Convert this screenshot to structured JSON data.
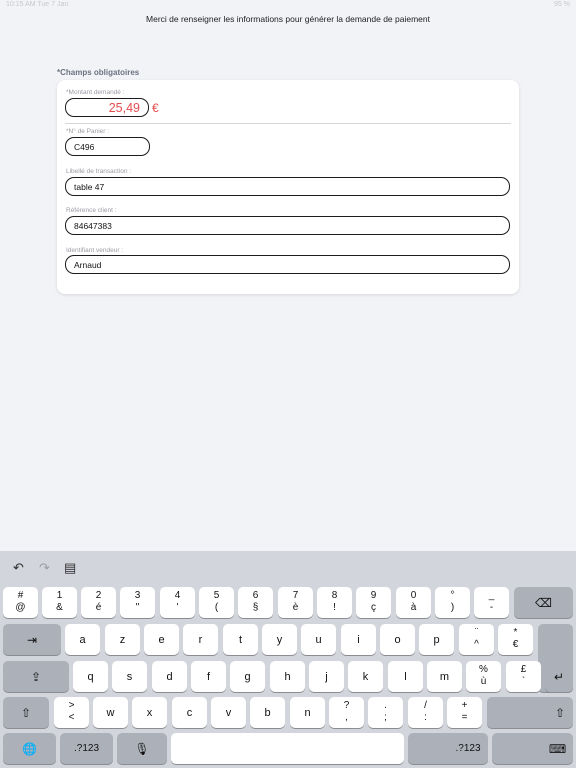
{
  "status": {
    "left": "10:15 AM   Tue 7 Jan",
    "right": "95 %"
  },
  "instruction": "Merci de renseigner les informations pour générer la demande de paiement",
  "required_label": "*Champs obligatoires",
  "form": {
    "amount": {
      "label": "*Montant demandé :",
      "value": "25,49",
      "currency": "€"
    },
    "cart": {
      "label": "*N° de Panier :",
      "value": "C496"
    },
    "transaction": {
      "label": "Libellé de transaction :",
      "value": "table 47"
    },
    "client_ref": {
      "label": "Référence client :",
      "value": "84647383"
    },
    "seller": {
      "label": "Identifiant vendeur :",
      "value": "Arnaud"
    }
  },
  "colors": {
    "accent": "#e74c4c",
    "background": "#f2f3f7",
    "keyboard": "#d3d5dc"
  },
  "keyboard": {
    "toolbar": {
      "undo": "↶",
      "redo": "↷",
      "paste": "▤"
    },
    "row1": [
      {
        "top": "#",
        "bot": "@"
      },
      {
        "top": "1",
        "bot": "&"
      },
      {
        "top": "2",
        "bot": "é"
      },
      {
        "top": "3",
        "bot": "\""
      },
      {
        "top": "4",
        "bot": "'"
      },
      {
        "top": "5",
        "bot": "("
      },
      {
        "top": "6",
        "bot": "§"
      },
      {
        "top": "7",
        "bot": "è"
      },
      {
        "top": "8",
        "bot": "!"
      },
      {
        "top": "9",
        "bot": "ç"
      },
      {
        "top": "0",
        "bot": "à"
      },
      {
        "top": "°",
        "bot": ")"
      },
      {
        "top": "_",
        "bot": "-"
      }
    ],
    "backspace": "⌫",
    "tab": "⇥",
    "row2": [
      "a",
      "z",
      "e",
      "r",
      "t",
      "y",
      "u",
      "i",
      "o",
      "p"
    ],
    "row2_extra": [
      {
        "top": "¨",
        "bot": "^"
      },
      {
        "top": "*",
        "bot": "€"
      }
    ],
    "capslock": "⇪",
    "row3": [
      "q",
      "s",
      "d",
      "f",
      "g",
      "h",
      "j",
      "k",
      "l",
      "m"
    ],
    "row3_extra": [
      {
        "top": "%",
        "bot": "ù"
      },
      {
        "top": "£",
        "bot": "`"
      }
    ],
    "return": "↵",
    "shift": "⇧",
    "row4_first": {
      "top": ">",
      "bot": "<"
    },
    "row4": [
      "w",
      "x",
      "c",
      "v",
      "b",
      "n"
    ],
    "row4_extra": [
      {
        "top": "?",
        "bot": ","
      },
      {
        "top": ".",
        "bot": ";"
      },
      {
        "top": "/",
        "bot": ":"
      },
      {
        "top": "+",
        "bot": "="
      }
    ],
    "globe": "🌐",
    "numbers": ".?123",
    "mic": "🎙",
    "hide": "⌨"
  }
}
